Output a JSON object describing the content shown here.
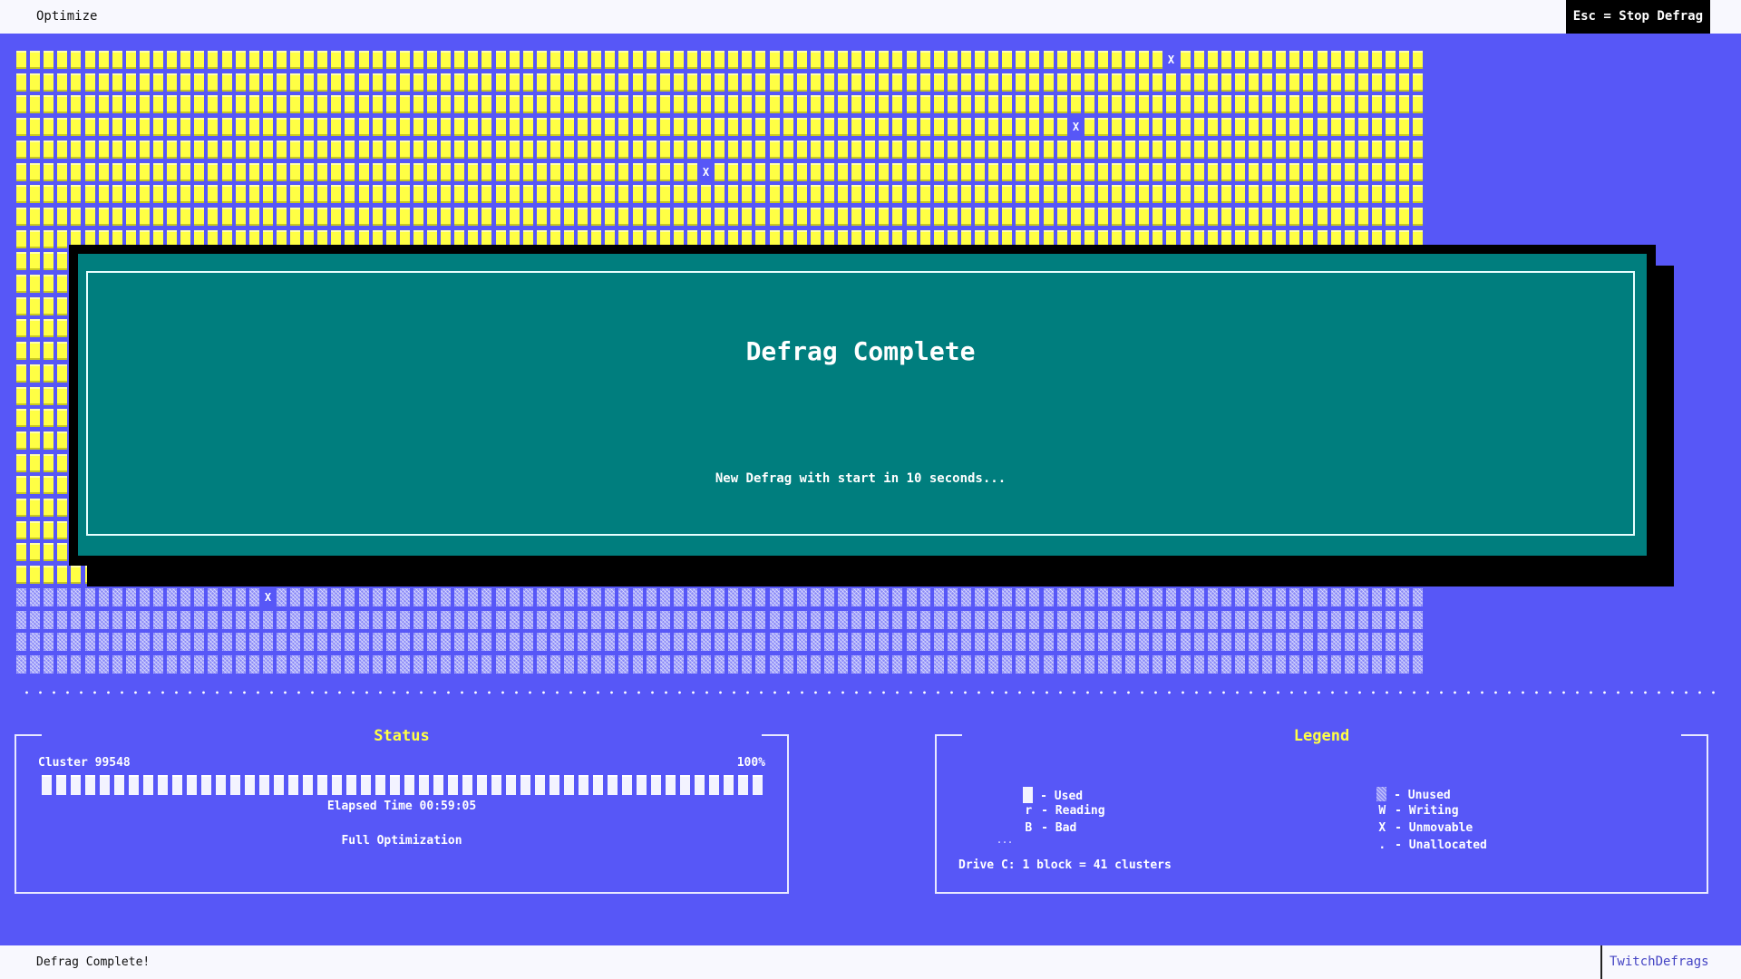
{
  "menu": {
    "optimize_label": "Optimize",
    "stop_label": "Esc = Stop Defrag"
  },
  "grid": {
    "columns": 103,
    "used_rows": 24,
    "unused_rows": 4,
    "unmovable_marker": "X",
    "unallocated_marker": ".",
    "colors": {
      "used": "#ffff44",
      "unused": "#8a8af8",
      "background": "#5757f7"
    }
  },
  "dialog": {
    "title": "Defrag Complete",
    "message": "New Defrag with start in 10 seconds...",
    "color": "#007e7e"
  },
  "status": {
    "title": "Status",
    "cluster": "Cluster 99548",
    "percent": "100%",
    "progress": 1.0,
    "elapsed": "Elapsed Time 00:59:05",
    "mode": "Full Optimization"
  },
  "legend": {
    "title": "Legend",
    "used": "- Used",
    "unused": "- Unused",
    "reading_sym": "r",
    "reading": "- Reading",
    "writing_sym": "W",
    "writing": "- Writing",
    "bad_sym": "B",
    "bad": "- Bad",
    "unmovable_sym": "X",
    "unmovable": "- Unmovable",
    "unallocated_sym": ".",
    "unallocated": "- Unallocated",
    "ellipsis": "...",
    "drive_info": "Drive C: 1 block = 41 clusters"
  },
  "footer": {
    "status": "Defrag Complete!",
    "brand": "TwitchDefrags"
  }
}
